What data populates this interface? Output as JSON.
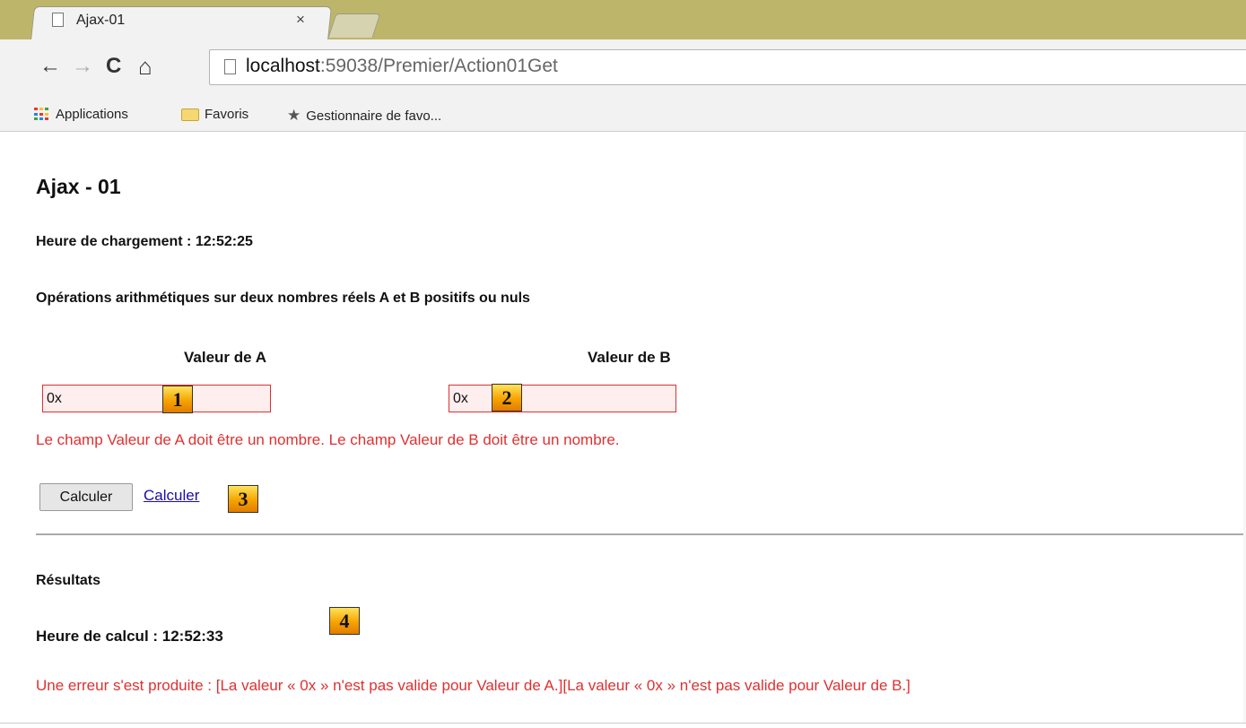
{
  "browser": {
    "tab_title": "Ajax-01",
    "tab_close": "×",
    "nav": {
      "back": "←",
      "forward": "→",
      "reload": "C",
      "home": "⌂"
    },
    "url_host": "localhost",
    "url_rest": ":59038/Premier/Action01Get",
    "bookmarks": [
      {
        "label": "Applications"
      },
      {
        "label": "Favoris"
      },
      {
        "label": "Gestionnaire de favo..."
      }
    ]
  },
  "page": {
    "title": "Ajax - 01",
    "load_time": "Heure de chargement : 12:52:25",
    "operations_heading": "Opérations arithmétiques sur deux nombres réels A et B positifs ou nuls",
    "label_a": "Valeur de A",
    "label_b": "Valeur de B",
    "input_a_value": "0x",
    "input_b_value": "0x",
    "validation_error": "Le champ Valeur de A doit être un nombre. Le champ Valeur de B doit être un nombre.",
    "button_label": "Calculer",
    "link_label": "Calculer",
    "results_heading": "Résultats",
    "calc_time": "Heure de calcul : 12:52:33",
    "result_error": "Une erreur s'est produite : [La valeur « 0x » n'est pas valide pour Valeur de A.][La valeur « 0x » n'est pas valide pour Valeur de B.]"
  },
  "markers": [
    "1",
    "2",
    "3",
    "4"
  ],
  "colors": {
    "error": "#e03030",
    "link": "#1a0dab",
    "tabstrip": "#bdb56a"
  }
}
